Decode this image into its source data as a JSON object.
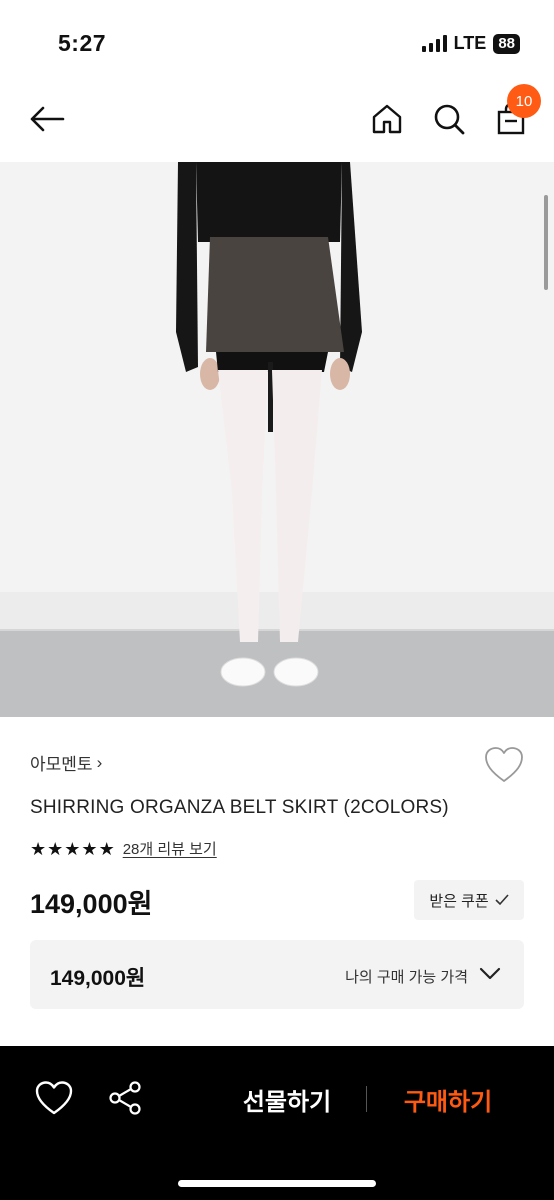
{
  "status": {
    "time": "5:27",
    "network": "LTE",
    "battery": "88"
  },
  "nav": {
    "cart_count": "10"
  },
  "product": {
    "brand": "아모멘토",
    "brand_arrow": "›",
    "title": "SHIRRING ORGANZA BELT SKIRT (2COLORS)",
    "rating_stars": 5,
    "review_text": "28개 리뷰 보기",
    "price": "149,000원",
    "coupon_label": "받은 쿠폰",
    "my_price": "149,000원",
    "my_price_label": "나의 구매 가능 가격"
  },
  "bottom": {
    "gift_label": "선물하기",
    "buy_label": "구매하기"
  },
  "colors": {
    "accent": "#ff5a12",
    "badge": "#ff5b14",
    "bottom_bar": "#000000",
    "image_bg": "#f2f2f2"
  },
  "icons": [
    "back-arrow-icon",
    "home-icon",
    "search-icon",
    "shopping-bag-icon",
    "heart-icon",
    "star-icon",
    "check-icon",
    "chevron-down-icon",
    "share-icon"
  ]
}
